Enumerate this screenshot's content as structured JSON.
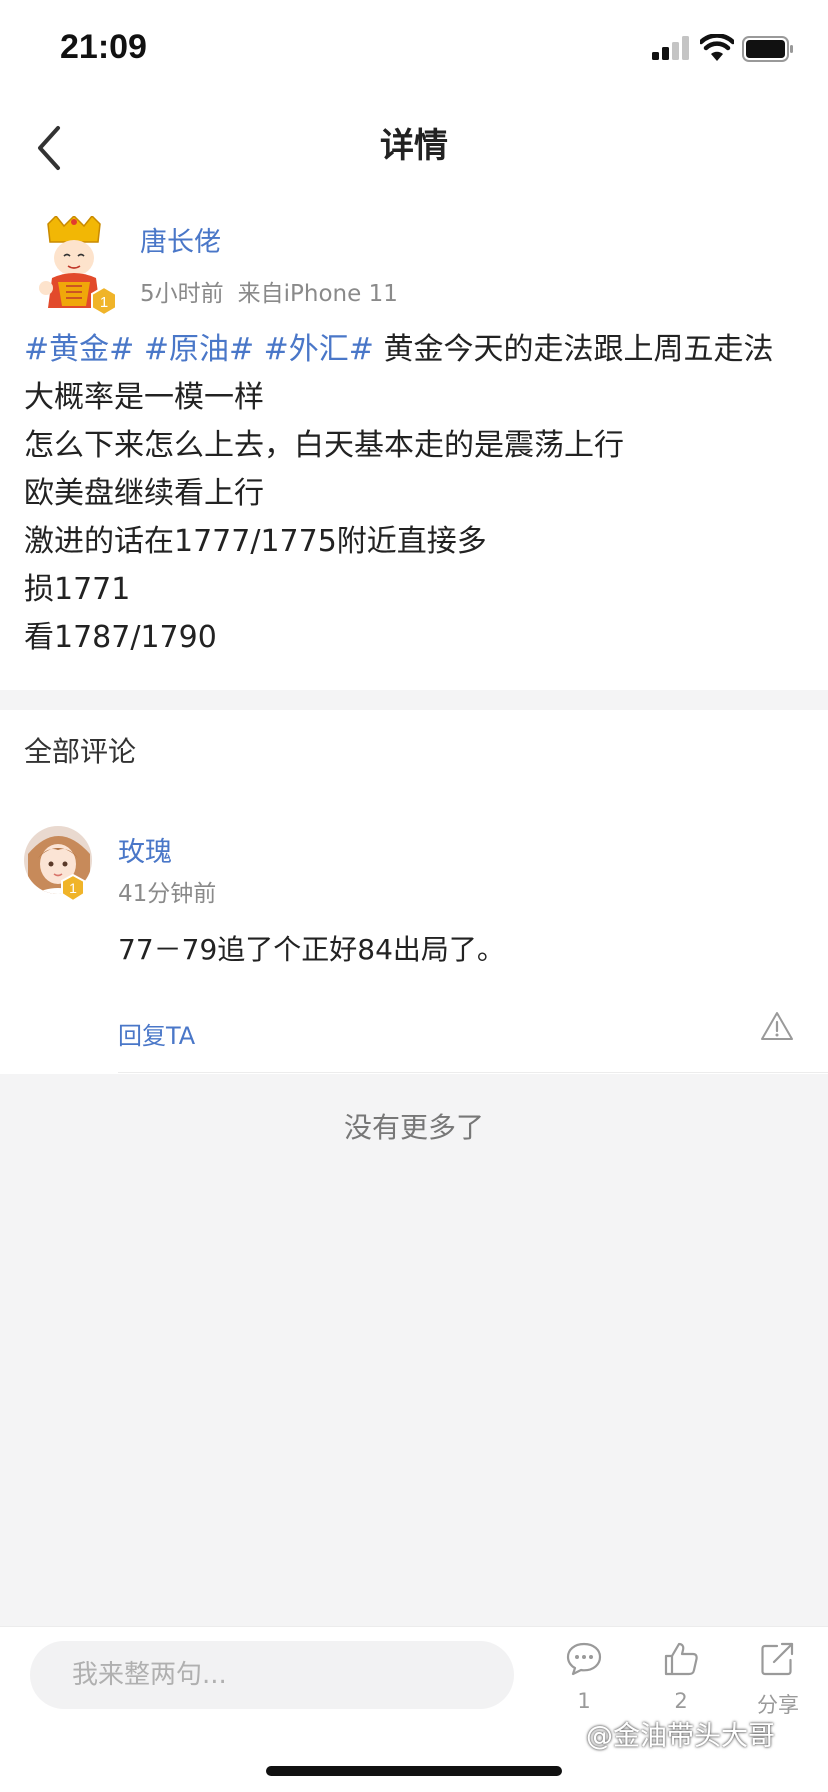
{
  "status_bar": {
    "time": "21:09"
  },
  "nav": {
    "title": "详情",
    "back_icon": "chevron-left-icon"
  },
  "post": {
    "author": "唐长佬",
    "badge_level": "1",
    "time_ago": "5小时前",
    "source": "来自iPhone 11",
    "tags": [
      "#黄金#",
      "#原油#",
      "#外汇#"
    ],
    "first_line_text": "黄金今天的走法跟上周五走法",
    "lines": [
      "大概率是一模一样",
      "怎么下来怎么上去，白天基本走的是震荡上行",
      "欧美盘继续看上行",
      "激进的话在1777/1775附近直接多",
      "损1771",
      "看1787/1790"
    ]
  },
  "comments_section": {
    "header": "全部评论",
    "comments": [
      {
        "name": "玫瑰",
        "badge_level": "1",
        "time": "41分钟前",
        "text": "77－79追了个正好84出局了。",
        "reply_label": "回复TA"
      }
    ],
    "no_more": "没有更多了"
  },
  "bottom_bar": {
    "input_placeholder": "我来整两句...",
    "comment_count": "1",
    "like_count": "2",
    "share_label": "分享"
  },
  "watermark": "@金油带头大哥",
  "colors": {
    "link_blue": "#4a77c8",
    "badge_gold": "#f0b429",
    "background_gray": "#f4f4f5"
  }
}
